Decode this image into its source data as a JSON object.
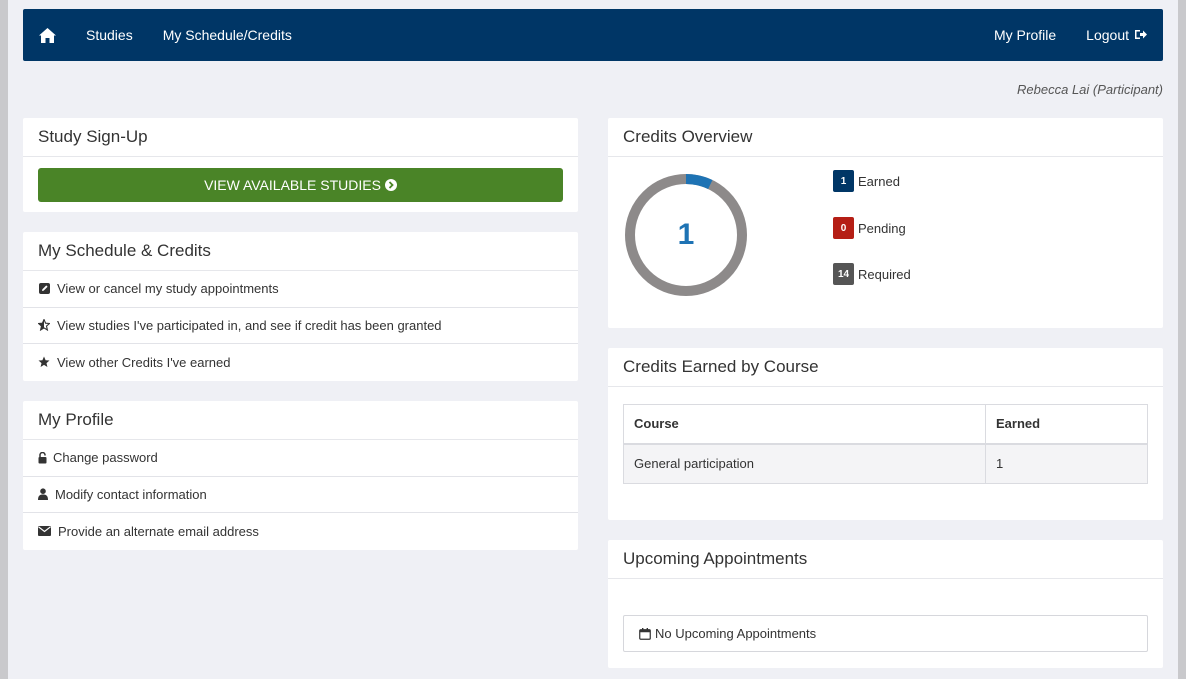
{
  "nav": {
    "home_icon": "home-icon",
    "studies": "Studies",
    "schedule": "My Schedule/Credits",
    "profile": "My Profile",
    "logout": "Logout"
  },
  "user": {
    "line": "Rebecca Lai (Participant)"
  },
  "signup": {
    "title": "Study Sign-Up",
    "button": "VIEW AVAILABLE STUDIES",
    "button_color": "#4a8427"
  },
  "schedule": {
    "title": "My Schedule & Credits",
    "items": [
      {
        "label": "View or cancel my study appointments",
        "icon": "edit-icon"
      },
      {
        "label": "View studies I've participated in, and see if credit has been granted",
        "icon": "half-star-icon"
      },
      {
        "label": "View other Credits I've earned",
        "icon": "star-icon"
      }
    ]
  },
  "profile": {
    "title": "My Profile",
    "items": [
      {
        "label": "Change password",
        "icon": "lock-icon"
      },
      {
        "label": "Modify contact information",
        "icon": "user-icon"
      },
      {
        "label": "Provide an alternate email address",
        "icon": "envelope-icon"
      }
    ]
  },
  "credits": {
    "title": "Credits Overview",
    "total": "1",
    "earned_fraction": 0.0714,
    "earned": {
      "value": "1",
      "label": "Earned",
      "color": "#003666"
    },
    "pending": {
      "value": "0",
      "label": "Pending",
      "color": "#b51e15"
    },
    "required": {
      "value": "14",
      "label": "Required",
      "color": "#555555"
    },
    "ring_color": "#8d8a8a",
    "earned_arc_color": "#1e73b4"
  },
  "by_course": {
    "title": "Credits Earned by Course",
    "headers": [
      "Course",
      "Earned"
    ],
    "rows": [
      [
        "General participation",
        "1"
      ]
    ]
  },
  "appointments": {
    "title": "Upcoming Appointments",
    "empty": "No Upcoming Appointments"
  }
}
